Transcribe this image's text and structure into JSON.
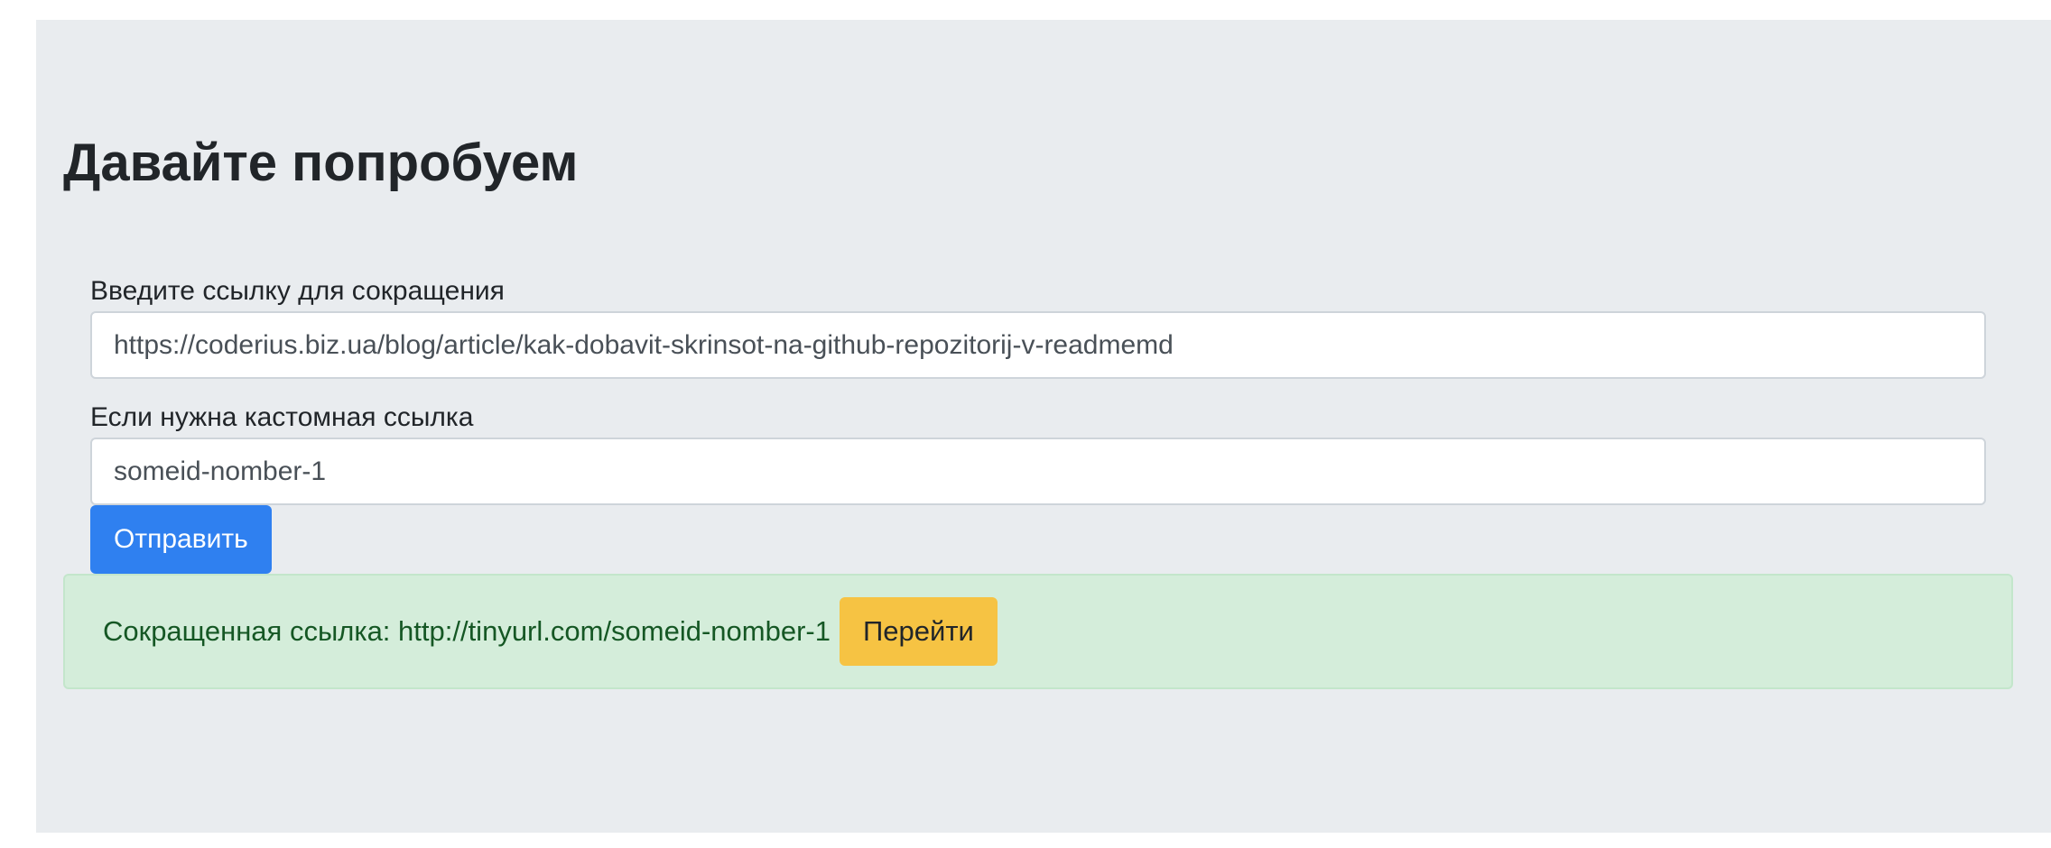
{
  "page": {
    "title": "Давайте попробуем"
  },
  "form": {
    "url_label": "Введите ссылку для сокращения",
    "url_value": "https://coderius.biz.ua/blog/article/kak-dobavit-skrinsot-na-github-repozitorij-v-readmemd",
    "custom_label": "Если нужна кастомная ссылка",
    "custom_value": "someid-nomber-1",
    "submit_label": "Отправить"
  },
  "result": {
    "text": "Сокращенная ссылка: http://tinyurl.com/someid-nomber-1",
    "go_label": "Перейти"
  },
  "colors": {
    "background": "#e9ecef",
    "primary": "#2f80f0",
    "success_bg": "#d4edda",
    "success_text": "#155724",
    "warning": "#f6c343"
  }
}
